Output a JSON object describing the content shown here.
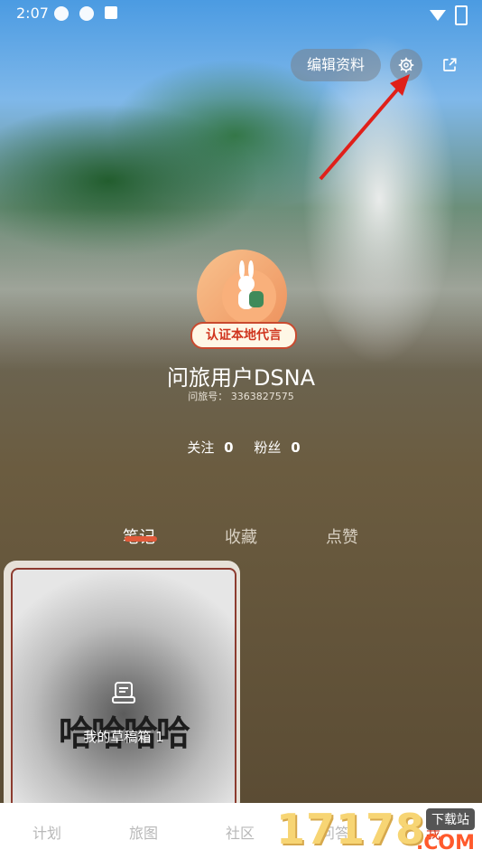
{
  "status": {
    "time": "2:07"
  },
  "header": {
    "edit_label": "编辑资料"
  },
  "profile": {
    "badge": "认证本地代言",
    "username": "问旅用户DSNA",
    "user_id_label": "问旅号：",
    "user_id": "3363827575",
    "follow_label": "关注",
    "follow_count": "0",
    "fans_label": "粉丝",
    "fans_count": "0"
  },
  "tabs": [
    {
      "label": "笔记"
    },
    {
      "label": "收藏"
    },
    {
      "label": "点赞"
    }
  ],
  "draft_card": {
    "big_text": "哈哈哈哈",
    "label": "我的草稿箱",
    "count": "1"
  },
  "bottom_nav": [
    {
      "label": "计划"
    },
    {
      "label": "旅图"
    },
    {
      "label": "社区"
    },
    {
      "label": "问答"
    },
    {
      "label": "我"
    }
  ],
  "watermark": {
    "digits": "17178",
    "tag": "下载站",
    "domain": ".COM"
  },
  "colors": {
    "accent": "#d0351f",
    "tab_underline": "#e05a3a",
    "arrow": "#e0201a"
  }
}
